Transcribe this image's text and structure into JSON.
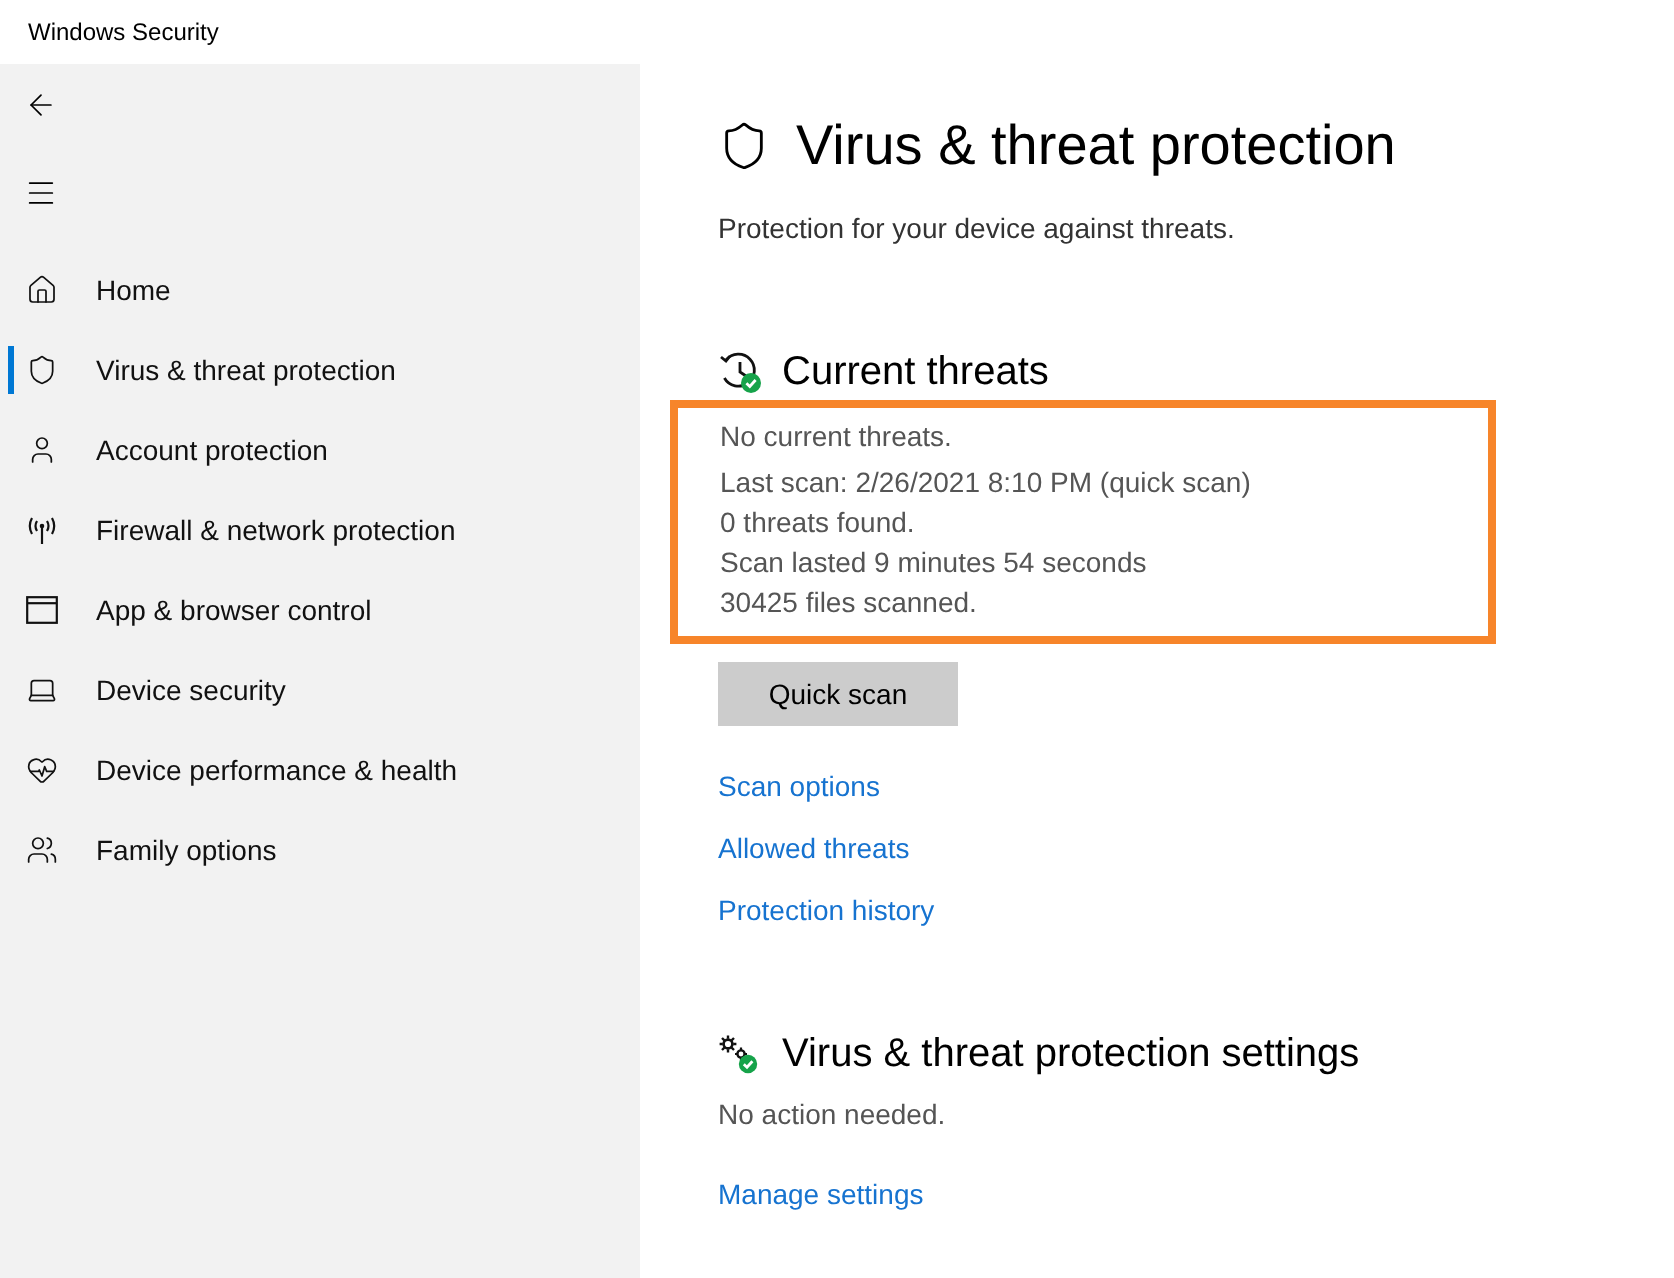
{
  "window": {
    "title": "Windows Security"
  },
  "sidebar": {
    "items": [
      {
        "label": "Home",
        "kind": "home",
        "selected": false
      },
      {
        "label": "Virus & threat protection",
        "kind": "shield",
        "selected": true
      },
      {
        "label": "Account protection",
        "kind": "account",
        "selected": false
      },
      {
        "label": "Firewall & network protection",
        "kind": "firewall",
        "selected": false
      },
      {
        "label": "App & browser control",
        "kind": "browser",
        "selected": false
      },
      {
        "label": "Device security",
        "kind": "device",
        "selected": false
      },
      {
        "label": "Device performance & health",
        "kind": "health",
        "selected": false
      },
      {
        "label": "Family options",
        "kind": "family",
        "selected": false
      }
    ]
  },
  "page": {
    "title": "Virus & threat protection",
    "subtitle": "Protection for your device against threats."
  },
  "current_threats": {
    "title": "Current threats",
    "ok": true,
    "highlighted": true,
    "status": "No current threats.",
    "details": [
      "Last scan: 2/26/2021 8:10 PM (quick scan)",
      "0 threats found.",
      "Scan lasted 9 minutes 54 seconds",
      "30425 files scanned."
    ],
    "button": "Quick scan",
    "links": [
      "Scan options",
      "Allowed threats",
      "Protection history"
    ]
  },
  "settings": {
    "title": "Virus & threat protection settings",
    "ok": true,
    "status": "No action needed.",
    "links": [
      "Manage settings"
    ]
  }
}
